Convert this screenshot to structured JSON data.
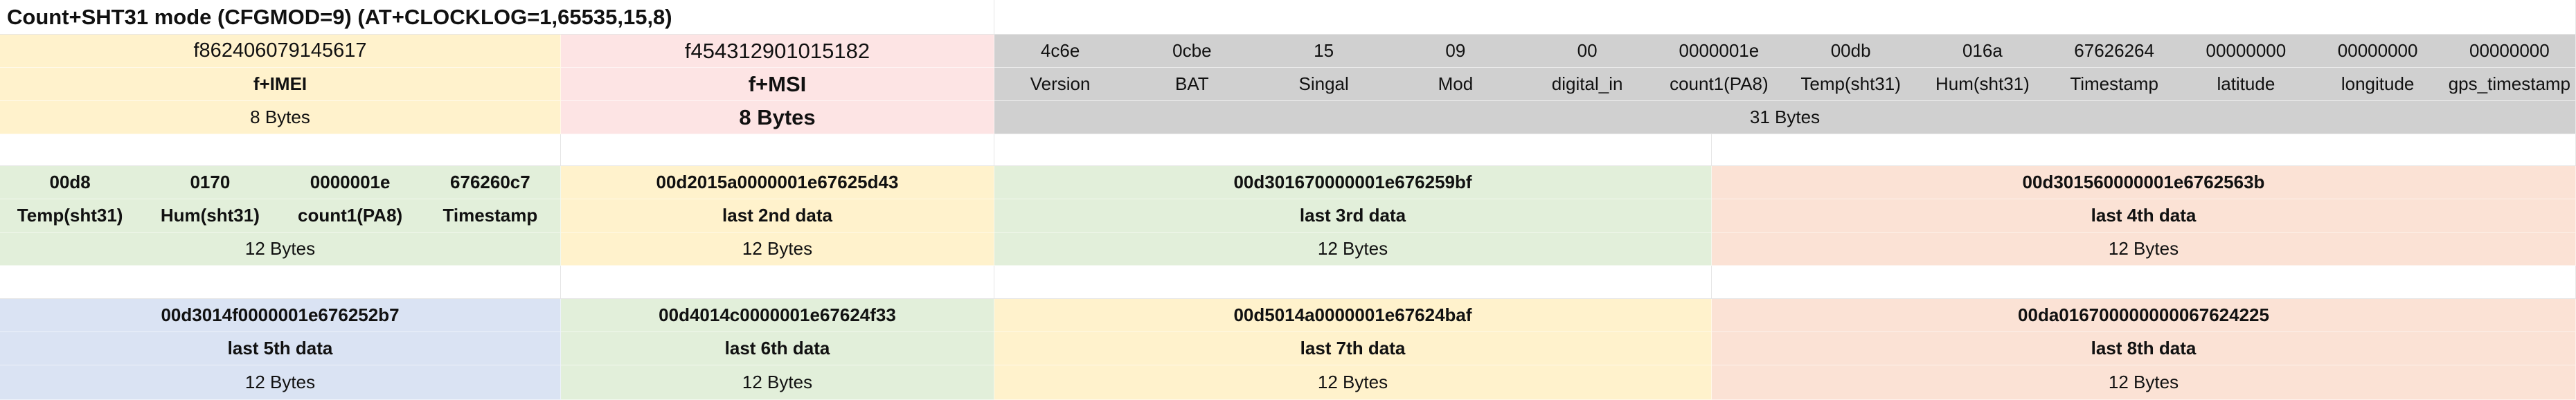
{
  "title": "Count+SHT31 mode  (CFGMOD=9)  (AT+CLOCKLOG=1,65535,15,8)",
  "frame": {
    "imei_value": "f862406079145617",
    "imei_label": "f+IMEI",
    "imei_bytes": "8 Bytes",
    "imsi_value": "f454312901015182",
    "imsi_label": "f+MSI",
    "imsi_bytes": "8 Bytes",
    "fields": [
      {
        "value": "4c6e",
        "label": "Version"
      },
      {
        "value": "0cbe",
        "label": "BAT"
      },
      {
        "value": "15",
        "label": "Singal"
      },
      {
        "value": "09",
        "label": "Mod"
      },
      {
        "value": "00",
        "label": "digital_in"
      },
      {
        "value": "0000001e",
        "label": "count1(PA8)"
      },
      {
        "value": "00db",
        "label": "Temp(sht31)"
      },
      {
        "value": "016a",
        "label": "Hum(sht31)"
      },
      {
        "value": "67626264",
        "label": "Timestamp"
      },
      {
        "value": "00000000",
        "label": "latitude"
      },
      {
        "value": "00000000",
        "label": "longitude"
      },
      {
        "value": "00000000",
        "label": "gps_timestamp"
      }
    ],
    "fields_bytes": "31 Bytes"
  },
  "last_data": {
    "first": {
      "values": [
        "00d8",
        "0170",
        "0000001e",
        "676260c7"
      ],
      "labels": [
        "Temp(sht31)",
        "Hum(sht31)",
        "count1(PA8)",
        "Timestamp"
      ],
      "bytes": "12 Bytes"
    },
    "row1": [
      {
        "value": "00d2015a0000001e67625d43",
        "label": "last 2nd data",
        "bytes": "12 Bytes"
      },
      {
        "value": "00d301670000001e676259bf",
        "label": "last 3rd data",
        "bytes": "12 Bytes"
      },
      {
        "value": "00d301560000001e6762563b",
        "label": "last 4th data",
        "bytes": "12 Bytes"
      }
    ],
    "row2": [
      {
        "value": "00d3014f0000001e676252b7",
        "label": "last 5th data",
        "bytes": "12 Bytes"
      },
      {
        "value": "00d4014c0000001e67624f33",
        "label": "last 6th data",
        "bytes": "12 Bytes"
      },
      {
        "value": "00d5014a0000001e67624baf",
        "label": "last 7th data",
        "bytes": "12 Bytes"
      },
      {
        "value": "00da016700000000067624225",
        "label": "last 8th data",
        "bytes": "12 Bytes"
      }
    ]
  },
  "colors": {
    "yellow": "#fff2cc",
    "pink": "#fde4e4",
    "gray": "#d0d0d0",
    "green": "#e2efda",
    "peach": "#fbe2d5",
    "blue": "#dae3f3"
  }
}
